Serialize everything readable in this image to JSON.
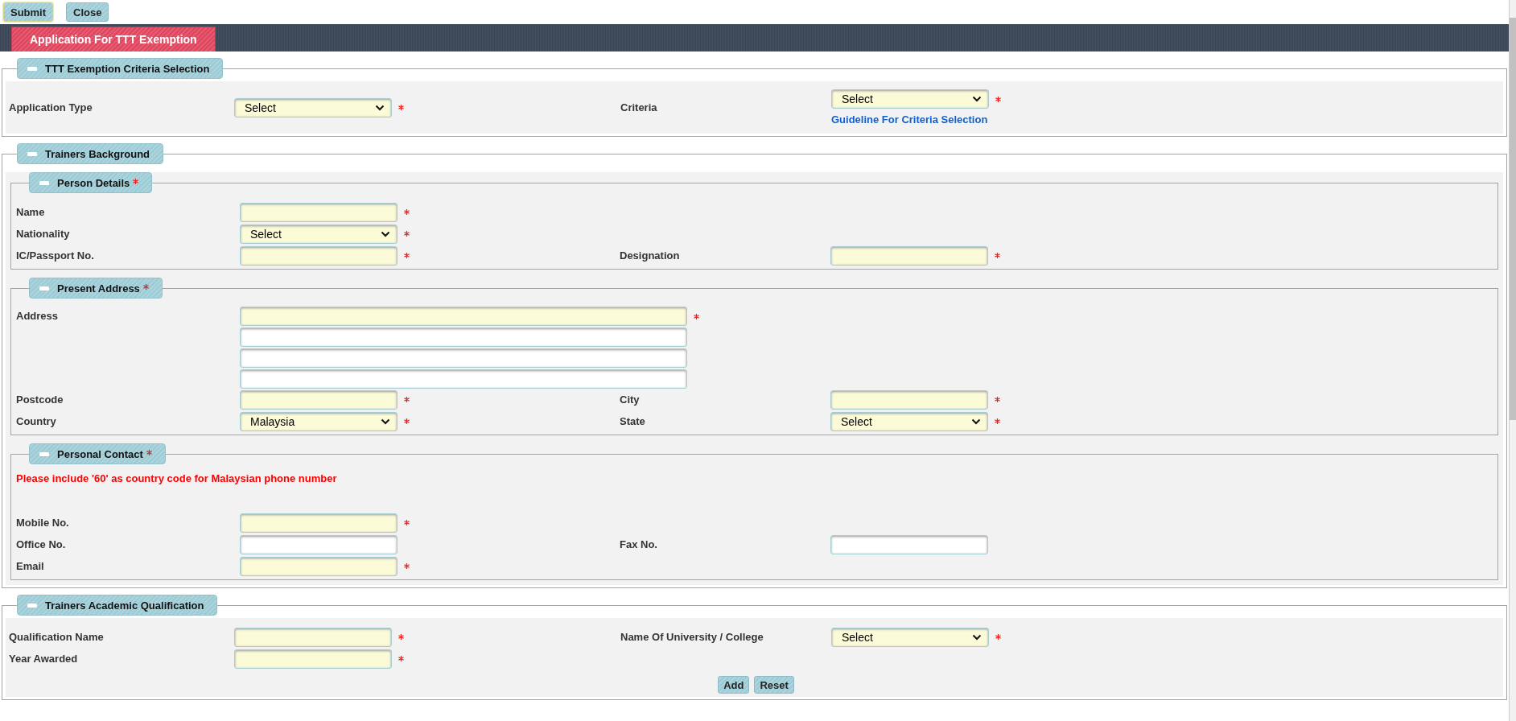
{
  "toolbar": {
    "buttons": [
      {
        "label": "Submit",
        "focused": true
      },
      {
        "label": "Close",
        "focused": false
      }
    ]
  },
  "page_tab": {
    "label": "Application For TTT Exemption"
  },
  "sections": [
    {
      "title": "TTT Exemption Criteria Selection",
      "required": false,
      "rows": [
        {
          "left": {
            "label": "Application Type",
            "kind": "select",
            "value": "Select",
            "required": true
          },
          "right": {
            "label": "Criteria",
            "kind": "select",
            "value": "Select",
            "required": true,
            "link": "Guideline For Criteria Selection"
          }
        }
      ]
    },
    {
      "title": "Trainers Background",
      "required": false,
      "children": [
        {
          "title": "Person Details",
          "required": true,
          "rows": [
            {
              "left": {
                "label": "Name",
                "kind": "text",
                "required": true
              }
            },
            {
              "left": {
                "label": "Nationality",
                "kind": "select",
                "value": "Select",
                "required": true
              }
            },
            {
              "left": {
                "label": "IC/Passport No.",
                "kind": "text",
                "required": true
              },
              "right": {
                "label": "Designation",
                "kind": "text",
                "required": true
              }
            }
          ]
        },
        {
          "title": "Present Address",
          "required": true,
          "rows": [
            {
              "left": {
                "label": "Address",
                "kind": "address",
                "lines": [
                  {
                    "required": true
                  },
                  {
                    "required": false
                  },
                  {
                    "required": false
                  },
                  {
                    "required": false
                  }
                ]
              }
            },
            {
              "left": {
                "label": "Postcode",
                "kind": "text",
                "required": true
              },
              "right": {
                "label": "City",
                "kind": "text",
                "required": true
              }
            },
            {
              "left": {
                "label": "Country",
                "kind": "select",
                "value": "Malaysia",
                "required": true
              },
              "right": {
                "label": "State",
                "kind": "select",
                "value": "Select",
                "required": true
              }
            }
          ]
        },
        {
          "title": "Personal Contact",
          "required": true,
          "note": "Please include '60' as country code for Malaysian phone number",
          "rows": [
            {
              "left": {
                "label": "Mobile No.",
                "kind": "text",
                "required": true
              }
            },
            {
              "left": {
                "label": "Office No.",
                "kind": "text",
                "required": false
              },
              "right": {
                "label": "Fax No.",
                "kind": "text",
                "required": false
              }
            },
            {
              "left": {
                "label": "Email",
                "kind": "text",
                "required": true
              }
            }
          ]
        }
      ]
    },
    {
      "title": "Trainers Academic Qualification",
      "required": false,
      "rows": [
        {
          "left": {
            "label": "Qualification Name",
            "kind": "text",
            "required": true
          },
          "right": {
            "label": "Name Of University / College",
            "kind": "select",
            "value": "Select",
            "required": true
          }
        },
        {
          "left": {
            "label": "Year Awarded",
            "kind": "text",
            "required": true
          }
        }
      ],
      "buttons": [
        "Add",
        "Reset"
      ]
    }
  ]
}
